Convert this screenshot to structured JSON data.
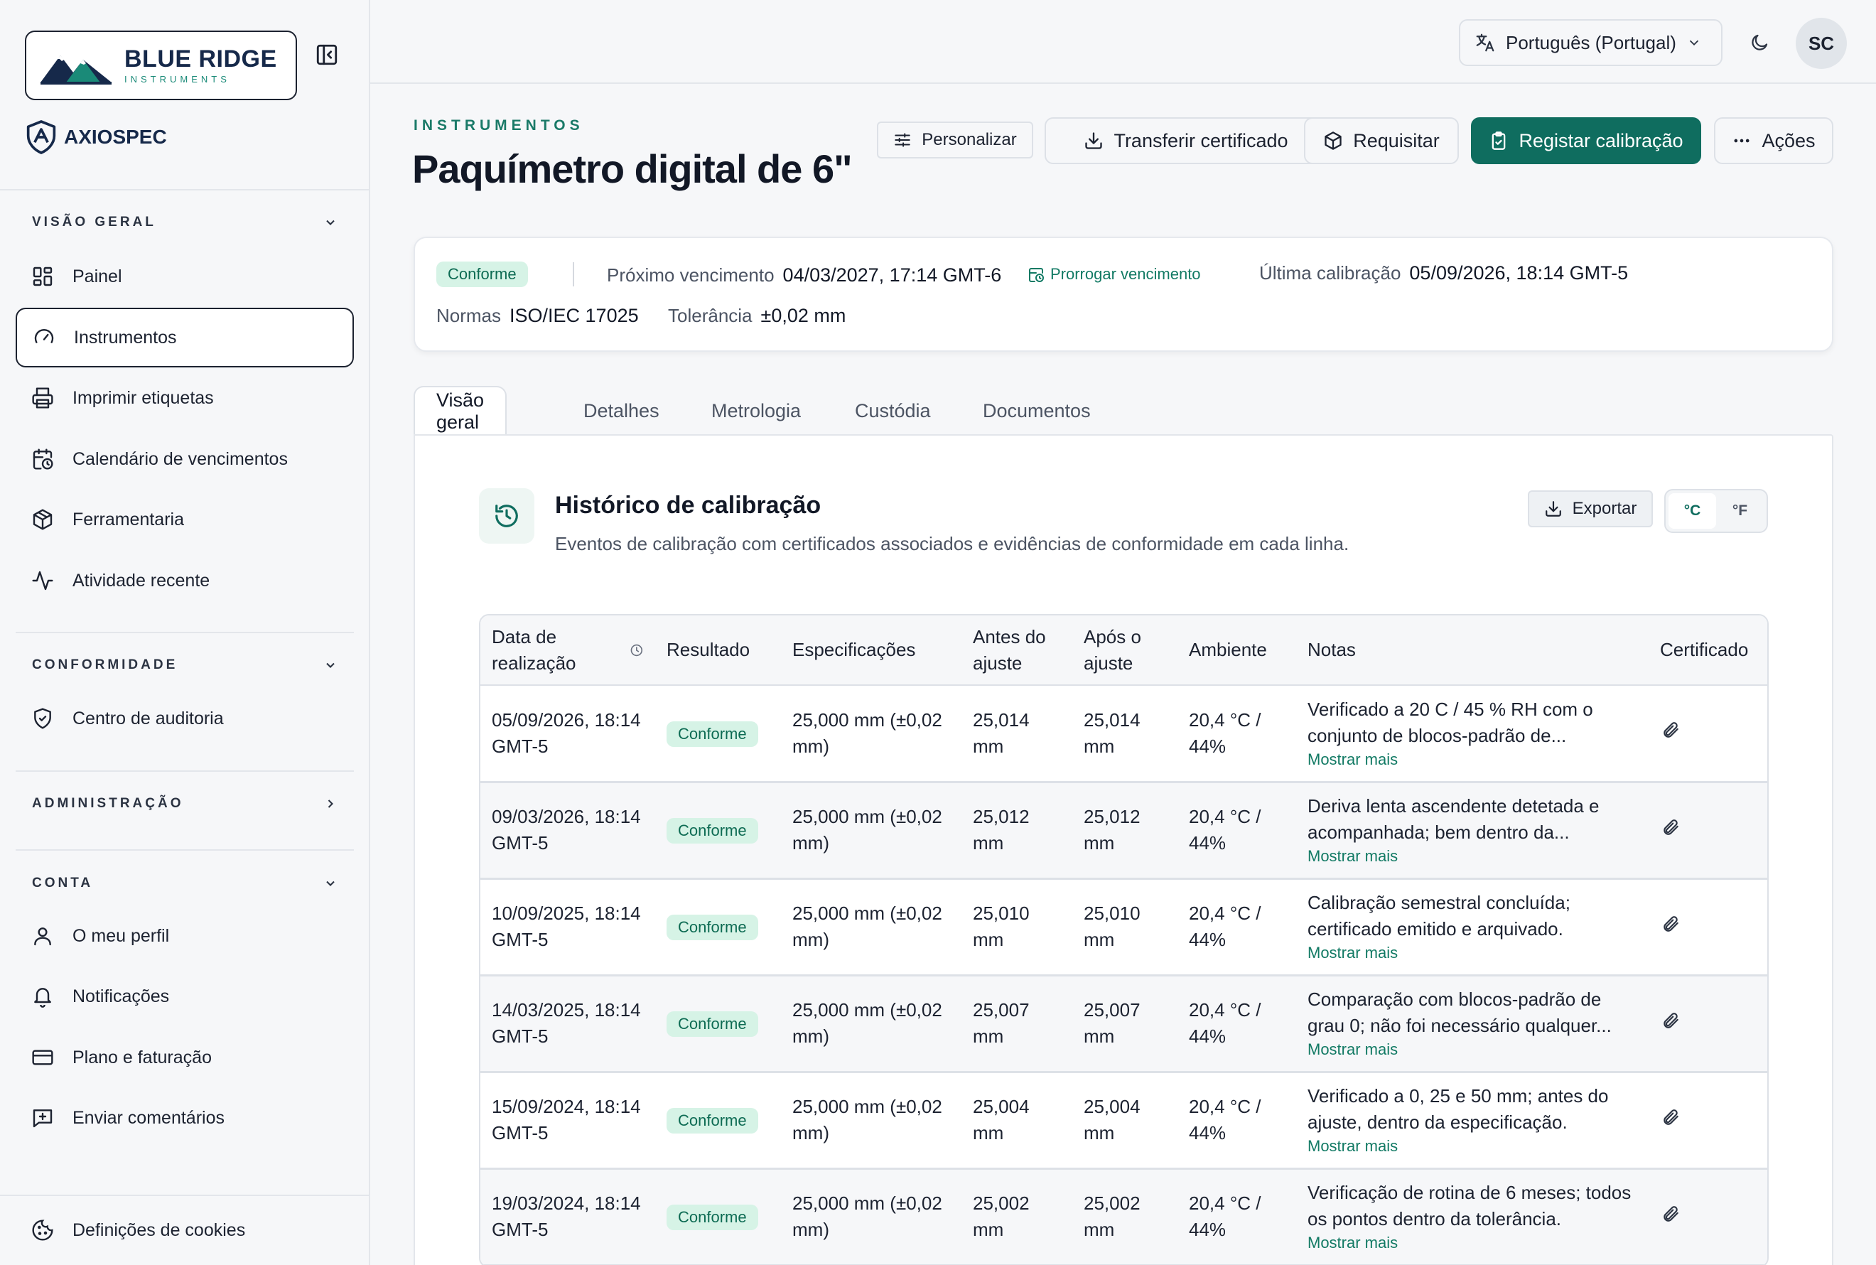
{
  "sidebar": {
    "brand": {
      "name": "BLUE RIDGE",
      "sub": "INSTRUMENTS"
    },
    "product": "AXIOSPEC",
    "sections": {
      "overview": "VISÃO GERAL",
      "compliance": "CONFORMIDADE",
      "admin": "ADMINISTRAÇÃO",
      "account": "CONTA"
    },
    "items": {
      "dashboard": "Painel",
      "instruments": "Instrumentos",
      "labels": "Imprimir etiquetas",
      "calendar": "Calendário de vencimentos",
      "tools": "Ferramentaria",
      "activity": "Atividade recente",
      "audit": "Centro de auditoria",
      "profile": "O meu perfil",
      "notifications": "Notificações",
      "billing": "Plano e faturação",
      "feedback": "Enviar comentários",
      "cookies": "Definições de cookies"
    }
  },
  "topbar": {
    "language": "Português (Portugal)",
    "avatar_initials": "SC"
  },
  "header": {
    "eyebrow": "INSTRUMENTOS",
    "title": "Paquímetro digital de 6\"",
    "buttons": {
      "customize": "Personalizar",
      "download_cert": "Transferir certificado",
      "request": "Requisitar",
      "log_calibration": "Registar calibração",
      "actions": "Ações"
    }
  },
  "summary": {
    "status": "Conforme",
    "next_due_label": "Próximo vencimento",
    "next_due_value": "04/03/2027, 17:14 GMT-6",
    "extend_link": "Prorrogar vencimento",
    "last_cal_label": "Última calibração",
    "last_cal_value": "05/09/2026, 18:14 GMT-5",
    "standards_label": "Normas",
    "standards_value": "ISO/IEC 17025",
    "tolerance_label": "Tolerância",
    "tolerance_value": "±0,02 mm"
  },
  "tabs": [
    "Visão geral",
    "Detalhes",
    "Metrologia",
    "Custódia",
    "Documentos"
  ],
  "history": {
    "title": "Histórico de calibração",
    "description": "Eventos de calibração com certificados associados e evidências de conformidade em cada linha.",
    "export_label": "Exportar",
    "unit_c": "°C",
    "unit_f": "°F",
    "columns": [
      "Data de realização",
      "Resultado",
      "Especificações",
      "Antes do ajuste",
      "Após o ajuste",
      "Ambiente",
      "Notas",
      "Certificado"
    ],
    "more_label": "Mostrar mais",
    "rows": [
      {
        "date": "05/09/2026, 18:14 GMT-5",
        "result": "Conforme",
        "spec": "25,000 mm (±0,02 mm)",
        "before": "25,014 mm",
        "after": "25,014 mm",
        "env": "20,4 °C / 44%",
        "notes": "Verificado a 20 C / 45 % RH com o conjunto de blocos-padrão de..."
      },
      {
        "date": "09/03/2026, 18:14 GMT-5",
        "result": "Conforme",
        "spec": "25,000 mm (±0,02 mm)",
        "before": "25,012 mm",
        "after": "25,012 mm",
        "env": "20,4 °C / 44%",
        "notes": "Deriva lenta ascendente detetada e acompanhada; bem dentro da..."
      },
      {
        "date": "10/09/2025, 18:14 GMT-5",
        "result": "Conforme",
        "spec": "25,000 mm (±0,02 mm)",
        "before": "25,010 mm",
        "after": "25,010 mm",
        "env": "20,4 °C / 44%",
        "notes": "Calibração semestral concluída; certificado emitido e arquivado."
      },
      {
        "date": "14/03/2025, 18:14 GMT-5",
        "result": "Conforme",
        "spec": "25,000 mm (±0,02 mm)",
        "before": "25,007 mm",
        "after": "25,007 mm",
        "env": "20,4 °C / 44%",
        "notes": "Comparação com blocos-padrão de grau 0; não foi necessário qualquer..."
      },
      {
        "date": "15/09/2024, 18:14 GMT-5",
        "result": "Conforme",
        "spec": "25,000 mm (±0,02 mm)",
        "before": "25,004 mm",
        "after": "25,004 mm",
        "env": "20,4 °C / 44%",
        "notes": "Verificado a 0, 25 e 50 mm; antes do ajuste, dentro da especificação."
      },
      {
        "date": "19/03/2024, 18:14 GMT-5",
        "result": "Conforme",
        "spec": "25,000 mm (±0,02 mm)",
        "before": "25,002 mm",
        "after": "25,002 mm",
        "env": "20,4 °C / 44%",
        "notes": "Verificação de rotina de 6 meses; todos os pontos dentro da tolerância."
      }
    ]
  }
}
